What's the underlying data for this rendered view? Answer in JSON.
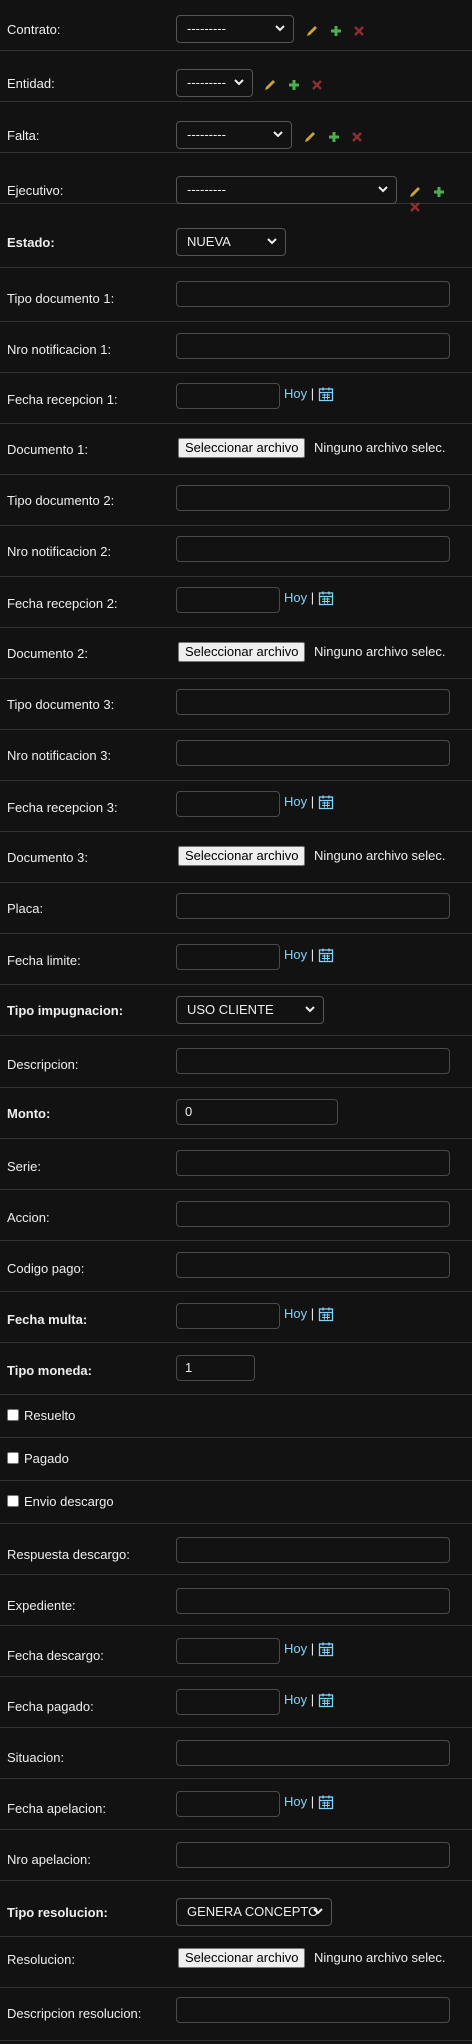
{
  "fields": {
    "contrato": {
      "label": "Contrato:",
      "value": "---------"
    },
    "entidad": {
      "label": "Entidad:",
      "value": "---------"
    },
    "falta": {
      "label": "Falta:",
      "value": "---------"
    },
    "ejecutivo": {
      "label": "Ejecutivo:",
      "value": "---------"
    },
    "estado": {
      "label": "Estado:",
      "value": "NUEVA"
    },
    "tipo_documento_1": {
      "label": "Tipo documento 1:",
      "value": ""
    },
    "nro_notificacion_1": {
      "label": "Nro notificacion 1:",
      "value": ""
    },
    "fecha_recepcion_1": {
      "label": "Fecha recepcion 1:",
      "value": ""
    },
    "documento_1": {
      "label": "Documento 1:"
    },
    "tipo_documento_2": {
      "label": "Tipo documento 2:",
      "value": ""
    },
    "nro_notificacion_2": {
      "label": "Nro notificacion 2:",
      "value": ""
    },
    "fecha_recepcion_2": {
      "label": "Fecha recepcion 2:",
      "value": ""
    },
    "documento_2": {
      "label": "Documento 2:"
    },
    "tipo_documento_3": {
      "label": "Tipo documento 3:",
      "value": ""
    },
    "nro_notificacion_3": {
      "label": "Nro notificacion 3:",
      "value": ""
    },
    "fecha_recepcion_3": {
      "label": "Fecha recepcion 3:",
      "value": ""
    },
    "documento_3": {
      "label": "Documento 3:"
    },
    "placa": {
      "label": "Placa:",
      "value": ""
    },
    "fecha_limite": {
      "label": "Fecha limite:",
      "value": ""
    },
    "tipo_impugnacion": {
      "label": "Tipo impugnacion:",
      "value": "USO CLIENTE"
    },
    "descripcion": {
      "label": "Descripcion:",
      "value": ""
    },
    "monto": {
      "label": "Monto:",
      "value": "0"
    },
    "serie": {
      "label": "Serie:",
      "value": ""
    },
    "accion": {
      "label": "Accion:",
      "value": ""
    },
    "codigo_pago": {
      "label": "Codigo pago:",
      "value": ""
    },
    "fecha_multa": {
      "label": "Fecha multa:",
      "value": ""
    },
    "tipo_moneda": {
      "label": "Tipo moneda:",
      "value": "1"
    },
    "resuelto": {
      "label": "Resuelto",
      "checked": false
    },
    "pagado": {
      "label": "Pagado",
      "checked": false
    },
    "envio_descargo": {
      "label": "Envio descargo",
      "checked": false
    },
    "respuesta_descargo": {
      "label": "Respuesta descargo:",
      "value": ""
    },
    "expediente": {
      "label": "Expediente:",
      "value": ""
    },
    "fecha_descargo": {
      "label": "Fecha descargo:",
      "value": ""
    },
    "fecha_pagado": {
      "label": "Fecha pagado:",
      "value": ""
    },
    "situacion": {
      "label": "Situacion:",
      "value": ""
    },
    "fecha_apelacion": {
      "label": "Fecha apelacion:",
      "value": ""
    },
    "nro_apelacion": {
      "label": "Nro apelacion:",
      "value": ""
    },
    "tipo_resolucion": {
      "label": "Tipo resolucion:",
      "value": "GENERA CONCEPTO"
    },
    "resolucion": {
      "label": "Resolucion:"
    },
    "descripcion_resolucion": {
      "label": "Descripcion resolucion:",
      "value": ""
    }
  },
  "common": {
    "hoy": "Hoy",
    "sep": "|",
    "file_button": "Seleccionar archivo",
    "file_none": "Ninguno archivo selec."
  },
  "icons": {
    "edit": "pencil-icon",
    "add": "plus-icon",
    "delete": "x-icon",
    "calendar": "calendar-icon",
    "dropdown": "chevron-down-icon"
  },
  "colors": {
    "background": "#121212",
    "border": "#333333",
    "link": "#81d4fa",
    "edit": "#c8a23a",
    "add": "#4caf50",
    "delete": "#8b2f2f"
  }
}
